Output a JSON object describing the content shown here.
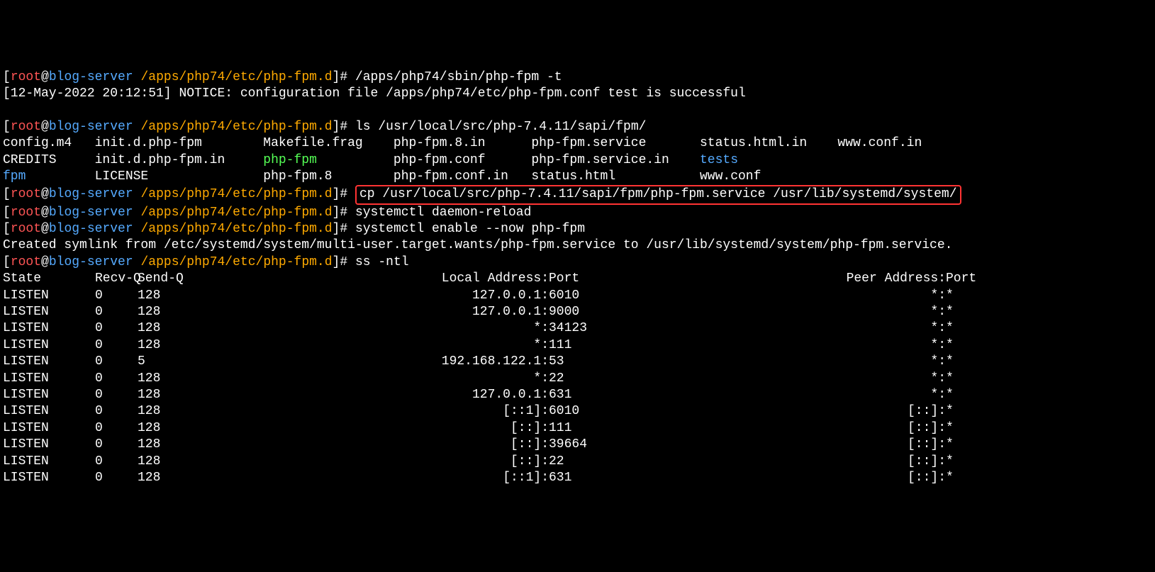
{
  "prompt": {
    "open": "[",
    "user": "root",
    "at": "@",
    "host": "blog-server",
    "path": "/apps/php74/etc/php-fpm.d",
    "close": "]#"
  },
  "cmd1": "/apps/php74/sbin/php-fpm -t",
  "notice": "[12-May-2022 20:12:51] NOTICE: configuration file /apps/php74/etc/php-fpm.conf test is successful",
  "cmd2": "ls /usr/local/src/php-7.4.11/sapi/fpm/",
  "ls": {
    "r1c1": "config.m4",
    "r1c2": "init.d.php-fpm",
    "r1c3": "Makefile.frag",
    "r1c4": "php-fpm.8.in",
    "r1c5": "php-fpm.service",
    "r1c6": "status.html.in",
    "r1c7": "www.conf.in",
    "r2c1": "CREDITS",
    "r2c2": "init.d.php-fpm.in",
    "r2c3": "php-fpm",
    "r2c4": "php-fpm.conf",
    "r2c5": "php-fpm.service.in",
    "r2c6": "tests",
    "r2c7": "",
    "r3c1": "fpm",
    "r3c2": "LICENSE",
    "r3c3": "php-fpm.8",
    "r3c4": "php-fpm.conf.in",
    "r3c5": "status.html",
    "r3c6": "www.conf",
    "r3c7": ""
  },
  "cmd3": "cp /usr/local/src/php-7.4.11/sapi/fpm/php-fpm.service /usr/lib/systemd/system/",
  "cmd4": "systemctl daemon-reload",
  "cmd5": "systemctl enable --now php-fpm",
  "symlink": "Created symlink from /etc/systemd/system/multi-user.target.wants/php-fpm.service to /usr/lib/systemd/system/php-fpm.service.",
  "cmd6": "ss -ntl",
  "ss_header": {
    "state": "State",
    "recvq": "Recv-Q",
    "sendq": "Send-Q",
    "local": "Local Address:",
    "lport": "Port",
    "peer": "Peer Address:",
    "pport": "Port"
  },
  "ss_rows": [
    {
      "state": "LISTEN",
      "recvq": "0",
      "sendq": "128",
      "local": "127.0.0.1:",
      "lport": "6010",
      "peer": "*:",
      "pport": "*"
    },
    {
      "state": "LISTEN",
      "recvq": "0",
      "sendq": "128",
      "local": "127.0.0.1:",
      "lport": "9000",
      "peer": "*:",
      "pport": "*"
    },
    {
      "state": "LISTEN",
      "recvq": "0",
      "sendq": "128",
      "local": "*:",
      "lport": "34123",
      "peer": "*:",
      "pport": "*"
    },
    {
      "state": "LISTEN",
      "recvq": "0",
      "sendq": "128",
      "local": "*:",
      "lport": "111",
      "peer": "*:",
      "pport": "*"
    },
    {
      "state": "LISTEN",
      "recvq": "0",
      "sendq": "5",
      "local": "192.168.122.1:",
      "lport": "53",
      "peer": "*:",
      "pport": "*"
    },
    {
      "state": "LISTEN",
      "recvq": "0",
      "sendq": "128",
      "local": "*:",
      "lport": "22",
      "peer": "*:",
      "pport": "*"
    },
    {
      "state": "LISTEN",
      "recvq": "0",
      "sendq": "128",
      "local": "127.0.0.1:",
      "lport": "631",
      "peer": "*:",
      "pport": "*"
    },
    {
      "state": "LISTEN",
      "recvq": "0",
      "sendq": "128",
      "local": "[::1]:",
      "lport": "6010",
      "peer": "[::]:",
      "pport": "*"
    },
    {
      "state": "LISTEN",
      "recvq": "0",
      "sendq": "128",
      "local": "[::]:",
      "lport": "111",
      "peer": "[::]:",
      "pport": "*"
    },
    {
      "state": "LISTEN",
      "recvq": "0",
      "sendq": "128",
      "local": "[::]:",
      "lport": "39664",
      "peer": "[::]:",
      "pport": "*"
    },
    {
      "state": "LISTEN",
      "recvq": "0",
      "sendq": "128",
      "local": "[::]:",
      "lport": "22",
      "peer": "[::]:",
      "pport": "*"
    },
    {
      "state": "LISTEN",
      "recvq": "0",
      "sendq": "128",
      "local": "[::1]:",
      "lport": "631",
      "peer": "[::]:",
      "pport": "*"
    }
  ]
}
